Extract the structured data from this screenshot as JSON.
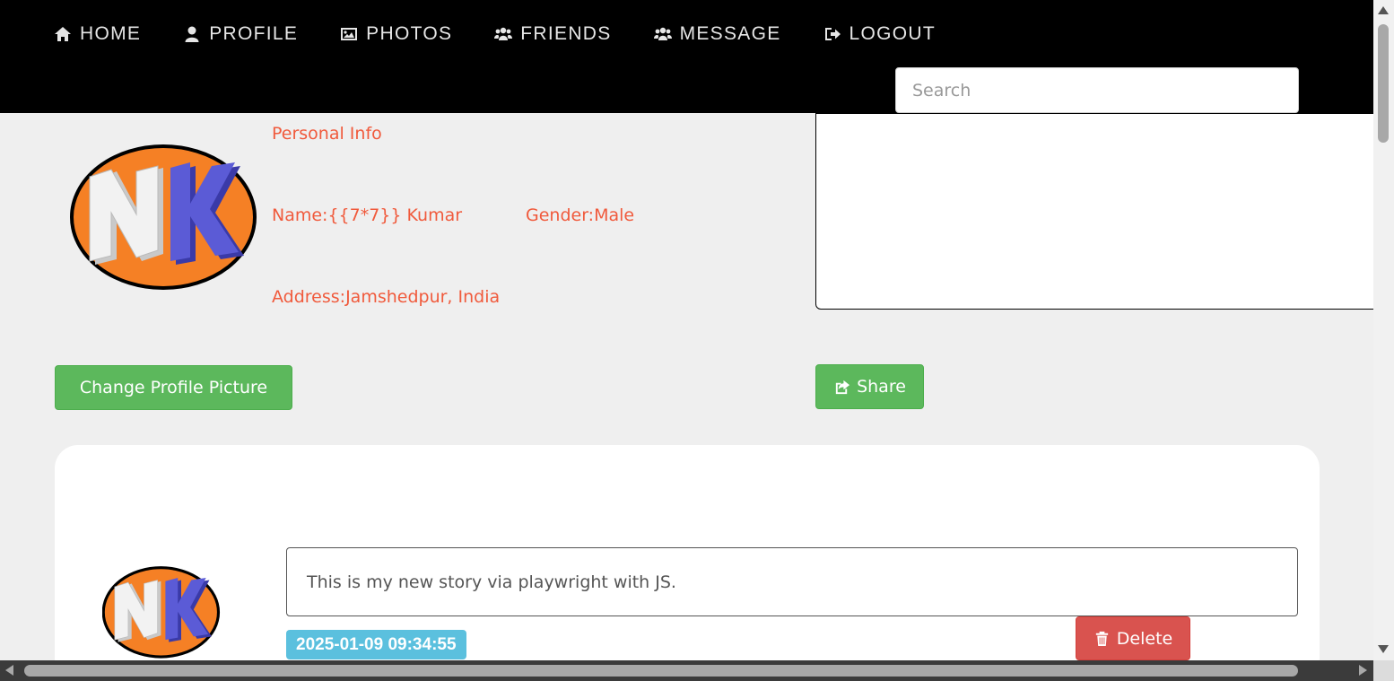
{
  "nav": {
    "items": [
      {
        "label": "HOME",
        "icon": "home-icon"
      },
      {
        "label": "PROFILE",
        "icon": "user-icon"
      },
      {
        "label": "PHOTOS",
        "icon": "image-icon"
      },
      {
        "label": "FRIENDS",
        "icon": "users-icon"
      },
      {
        "label": "MESSAGE",
        "icon": "users-icon"
      },
      {
        "label": "LOGOUT",
        "icon": "sign-out-icon"
      }
    ]
  },
  "search": {
    "placeholder": "Search",
    "value": ""
  },
  "profile": {
    "avatar_initials": "NK",
    "section_title": "Personal Info",
    "name": "Name:{{7*7}} Kumar",
    "gender": "Gender:Male",
    "address": "Address:Jamshedpur, India",
    "change_picture_label": "Change Profile Picture",
    "share_label": "Share"
  },
  "story": {
    "text": "This is my new story via playwright with JS.",
    "timestamp": "2025-01-09 09:34:55",
    "delete_label": "Delete"
  },
  "colors": {
    "nav_bg": "#000000",
    "accent_text": "#f05a3c",
    "button_green": "#5cb85c",
    "button_red": "#d9534f",
    "badge_blue": "#5bc0de"
  }
}
